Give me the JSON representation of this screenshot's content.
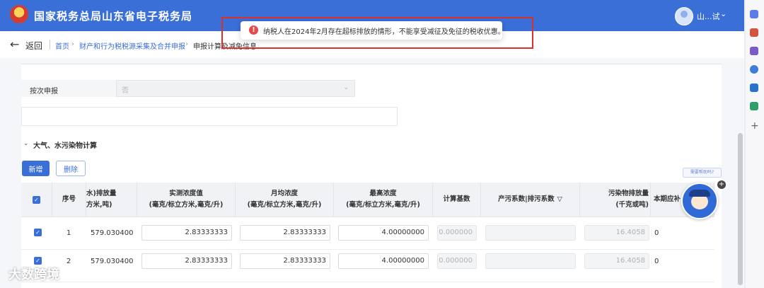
{
  "header": {
    "title": "国家税务总局山东省电子税务局",
    "user_name": "山...试",
    "caret": "⌄"
  },
  "breadcrumb": {
    "back": "返回",
    "home": "首页",
    "middle": "财产和行为税税源采集及合并申报",
    "current": "申报计算及减免信息",
    "sep": "›"
  },
  "toast": {
    "icon": "!",
    "message": "纳税人在2024年2月存在超标排放的情形，不能享受减征及免征的税收优惠。"
  },
  "form": {
    "label": "按次申报",
    "select_value": "否",
    "select_caret": "⌄"
  },
  "section": {
    "title": "大气、水污染物计算",
    "caret": "⌄"
  },
  "buttons": {
    "add": "新增",
    "delete": "删除",
    "help": "需要帮助吗?"
  },
  "table": {
    "headers": {
      "seq": "序号",
      "emission": "水)排放量\n方米,吨)",
      "measured": "实测浓度值\n(毫克/标立方米,毫克/升)",
      "monthly": "月均浓度\n(毫克/标立方米,毫克/升)",
      "max": "最高浓度\n(毫克/标立方米,毫克/升)",
      "base": "计算基数",
      "factor": "产污系数|排污系数",
      "pollutant": "污染物排放量\n(千克或吨)",
      "current": "本期应补"
    },
    "rows": [
      {
        "seq": "1",
        "emission": "579.030400",
        "measured": "2.83333333",
        "monthly": "2.83333333",
        "max": "4.00000000",
        "base": "0.000000",
        "factor": "",
        "pollutant": "16.4058",
        "current": "0"
      },
      {
        "seq": "2",
        "emission": "579.030400",
        "measured": "2.83333333",
        "monthly": "2.83333333",
        "max": "4.00000000",
        "base": "0.000000",
        "factor": "",
        "pollutant": "16.4058",
        "current": "0"
      }
    ],
    "check_glyph": "✓",
    "filter_glyph": "▽"
  },
  "watermark": "大数跨境",
  "colors": {
    "brand": "#3b6fd8",
    "error": "#e5484d",
    "highlight": "#d9302b"
  }
}
